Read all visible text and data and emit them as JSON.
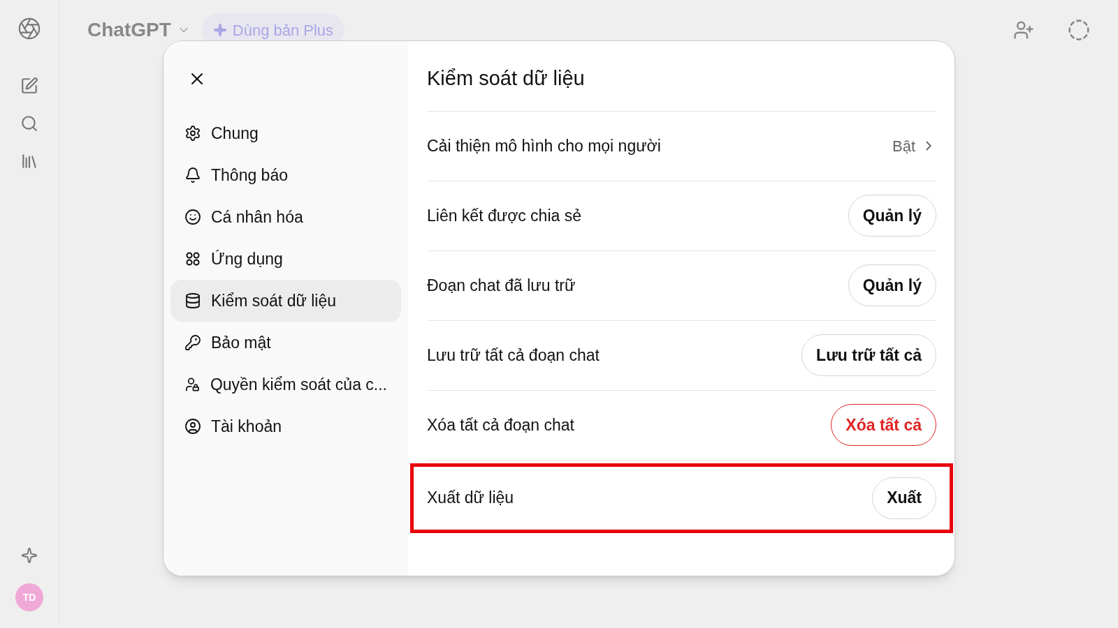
{
  "app_header": {
    "title": "ChatGPT",
    "upgrade": "Dùng bản Plus"
  },
  "avatar": {
    "initials": "TD",
    "color": "#f0a8d8"
  },
  "settings": {
    "sidebar": [
      {
        "label": "Chung",
        "selected": false
      },
      {
        "label": "Thông báo",
        "selected": false
      },
      {
        "label": "Cá nhân hóa",
        "selected": false
      },
      {
        "label": "Ứng dụng",
        "selected": false
      },
      {
        "label": "Kiểm soát dữ liệu",
        "selected": true
      },
      {
        "label": "Bảo mật",
        "selected": false
      },
      {
        "label": "Quyền kiểm soát của c...",
        "selected": false
      },
      {
        "label": "Tài khoản",
        "selected": false
      }
    ],
    "title": "Kiểm soát dữ liệu",
    "rows": [
      {
        "label": "Cải thiện mô hình cho mọi người",
        "kind": "link",
        "value": "Bật",
        "highlighted": false
      },
      {
        "label": "Liên kết được chia sẻ",
        "kind": "button",
        "button": "Quản lý",
        "danger": false,
        "highlighted": false
      },
      {
        "label": "Đoạn chat đã lưu trữ",
        "kind": "button",
        "button": "Quản lý",
        "danger": false,
        "highlighted": false
      },
      {
        "label": "Lưu trữ tất cả đoạn chat",
        "kind": "button",
        "button": "Lưu trữ tất cả",
        "danger": false,
        "highlighted": false
      },
      {
        "label": "Xóa tất cả đoạn chat",
        "kind": "button",
        "button": "Xóa tất cả",
        "danger": true,
        "highlighted": false
      },
      {
        "label": "Xuất dữ liệu",
        "kind": "button",
        "button": "Xuất",
        "danger": false,
        "highlighted": true
      }
    ]
  }
}
